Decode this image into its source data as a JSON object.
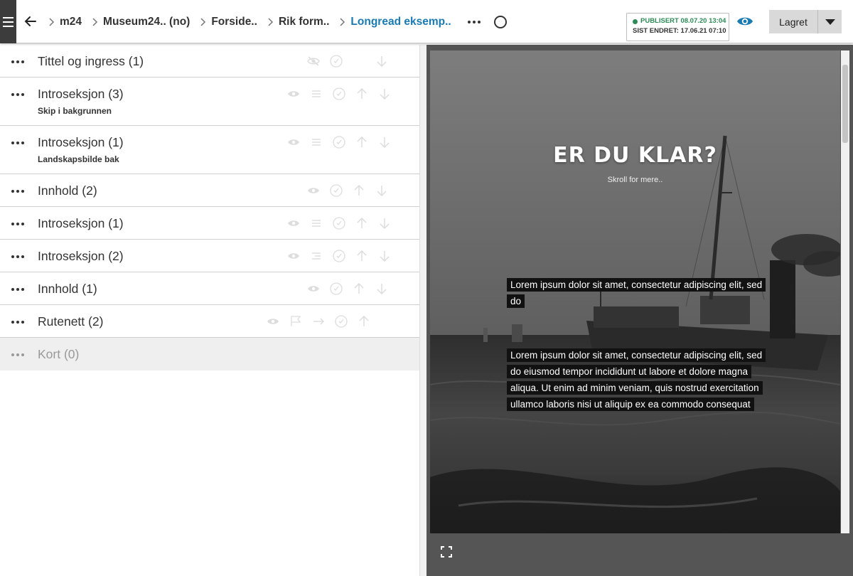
{
  "header": {
    "breadcrumbs": [
      {
        "label": "m24"
      },
      {
        "label": "Museum24.. (no)"
      },
      {
        "label": "Forside.."
      },
      {
        "label": "Rik form.."
      },
      {
        "label": "Longread eksemp..",
        "active": true
      }
    ],
    "status": {
      "published": "PUBLISERT 08.07.20 13:04",
      "changed": "SIST ENDRET: 17.06.21 07:10",
      "color": "#2e8b57"
    },
    "save_label": "Lagret",
    "icons": [
      "menu-icon",
      "arrow-left-icon",
      "more-icon",
      "circle-icon",
      "eye-icon",
      "caret-down-icon"
    ]
  },
  "sections": [
    {
      "title": "Tittel og ingress (1)",
      "subtitle": ""
    },
    {
      "title": "Introseksjon (3)",
      "subtitle": "Skip i bakgrunnen"
    },
    {
      "title": "Introseksjon (1)",
      "subtitle": "Landskapsbilde bak"
    },
    {
      "title": "Innhold (2)",
      "subtitle": ""
    },
    {
      "title": "Introseksjon (1)",
      "subtitle": ""
    },
    {
      "title": "Introseksjon (2)",
      "subtitle": ""
    },
    {
      "title": "Innhold (1)",
      "subtitle": ""
    },
    {
      "title": "Rutenett (2)",
      "subtitle": ""
    },
    {
      "title": "Kort (0)",
      "subtitle": ""
    }
  ],
  "preview": {
    "heading": "ER DU KLAR?",
    "subheading": "Skroll for mere..",
    "block1": "Lorem ipsum dolor sit amet, consectetur adipiscing elit, sed do",
    "block2": "Lorem ipsum dolor sit amet, consectetur adipiscing elit, sed do eiusmod tempor incididunt ut labore et dolore magna aliqua. Ut enim ad minim veniam, quis nostrud exercitation ullamco laboris nisi ut aliquip ex ea commodo consequat"
  },
  "colors": {
    "accent": "#1a7ab2",
    "sidebar_dark": "#3c3c3c",
    "button_bg": "#d9d9d9"
  }
}
